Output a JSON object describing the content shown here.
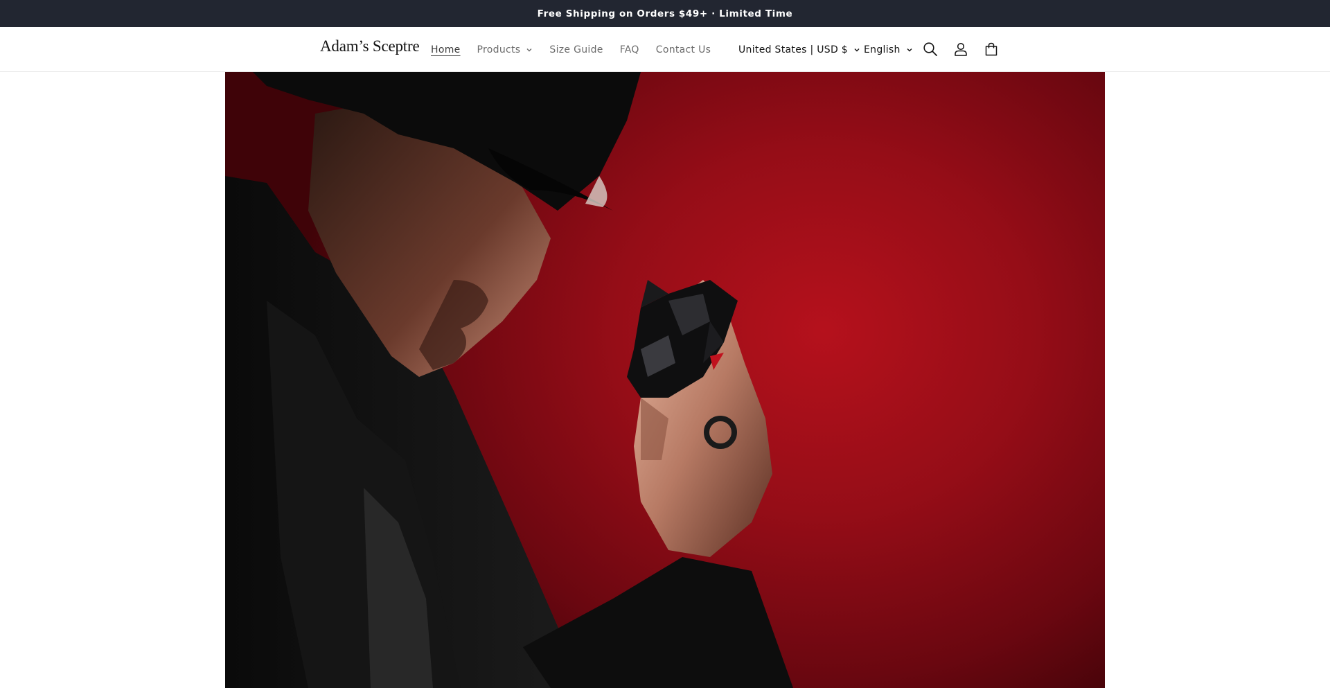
{
  "announcement": {
    "text": "Free Shipping on Orders $49+ · Limited Time"
  },
  "header": {
    "logo": "Adam’s Sceptre",
    "nav": [
      {
        "label": "Home",
        "active": true
      },
      {
        "label": "Products",
        "has_dropdown": true
      },
      {
        "label": "Size Guide"
      },
      {
        "label": "FAQ"
      },
      {
        "label": "Contact Us"
      }
    ],
    "country_selector": "United States | USD $",
    "language_selector": "English",
    "icons": [
      "search-icon",
      "account-icon",
      "cart-icon"
    ]
  },
  "hero": {
    "image": "man in black fedora and dark coat holding a black geometric wolf-head device against a red background"
  },
  "colors": {
    "announcement_bg": "#222631",
    "hero_red": "#b5111c",
    "text": "#121212",
    "nav_muted": "#6b6b6b"
  }
}
